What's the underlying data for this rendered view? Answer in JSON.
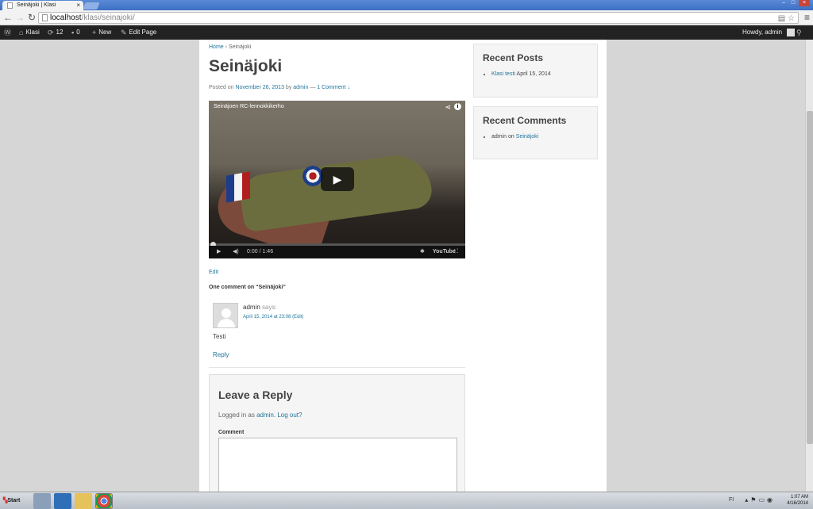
{
  "browser": {
    "tab_title": "Seinäjoki | Klasi",
    "url_host": "localhost",
    "url_path": "/klasi/seinajoki/"
  },
  "adminbar": {
    "site_name": "Klasi",
    "updates_count": "12",
    "comments_count": "0",
    "new_label": "New",
    "edit_page_label": "Edit Page",
    "howdy": "Howdy, admin"
  },
  "breadcrumb": {
    "home": "Home",
    "sep": "›",
    "current": "Seinäjoki"
  },
  "post": {
    "title": "Seinäjoki",
    "posted_on": "Posted on",
    "date": "November 26, 2013",
    "by": "by",
    "author": "admin",
    "dash": "—",
    "comments_link": "1 Comment ↓",
    "edit_label": "Edit"
  },
  "video": {
    "title": "Seinäjoen RC-lennokkikerho",
    "time": "0:00 / 1:46",
    "brand": "YouTube"
  },
  "comments": {
    "heading": "One comment on “Seinäjoki”",
    "items": [
      {
        "author": "admin",
        "says": "says:",
        "date": "April 15, 2014 at 23:08",
        "edit": "(Edit)",
        "text": "Testi",
        "reply": "Reply"
      }
    ]
  },
  "reply_form": {
    "title": "Leave a Reply",
    "logged_in_as": "Logged in as",
    "user": "admin",
    "logout": "Log out?",
    "comment_label": "Comment"
  },
  "sidebar": {
    "recent_posts": {
      "title": "Recent Posts",
      "items": [
        {
          "link": "Klasi testi",
          "date": "April 15, 2014"
        }
      ]
    },
    "recent_comments": {
      "title": "Recent Comments",
      "items": [
        {
          "author": "admin",
          "on": "on",
          "post": "Seinäjoki"
        }
      ]
    }
  },
  "taskbar": {
    "start": "Start",
    "lang": "FI",
    "time": "1:07 AM",
    "date": "4/16/2014"
  }
}
